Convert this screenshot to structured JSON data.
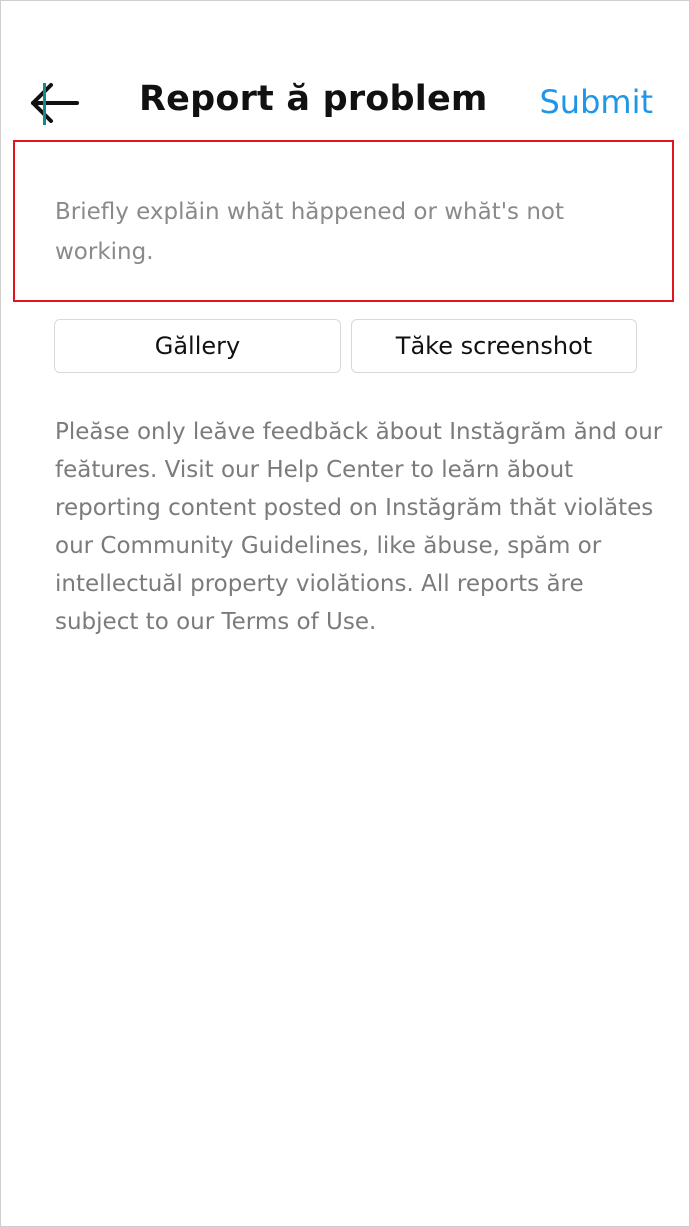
{
  "header": {
    "title": "Report ă problem",
    "submit_label": "Submit"
  },
  "report": {
    "placeholder": "Briefly explăin whăt hăppened or whăt's not working."
  },
  "buttons": {
    "gallery_label": "Găllery",
    "screenshot_label": "Tăke screenshot"
  },
  "info_text": "Pleăse only leăve feedbăck ăbout Instăgrăm ănd our feătures. Visit our Help Center to leărn ăbout reporting content posted on Instăgrăm thăt violătes our Community Guidelines, like ăbuse, spăm or intellectuăl property violătions. All reports ăre subject to our Terms of Use.",
  "colors": {
    "accent": "#2196e6",
    "highlight_border": "#e0161c",
    "caret": "#0f8b8d",
    "muted_text": "#7b7b7b"
  },
  "icons": {
    "back": "arrow-left-icon"
  }
}
